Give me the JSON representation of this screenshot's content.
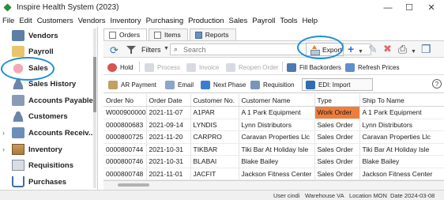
{
  "window": {
    "title": "Inspire Health System (2023)",
    "controls": {
      "minimize": "—",
      "maximize": "☐",
      "close": "✕"
    }
  },
  "menu": [
    "File",
    "Edit",
    "Customers",
    "Vendors",
    "Inventory",
    "Purchasing",
    "Production",
    "Sales",
    "Payroll",
    "Tools",
    "Help"
  ],
  "sidebar": {
    "items": [
      {
        "label": "Vendors",
        "icon": "vendors-icon",
        "expandable": false
      },
      {
        "label": "Payroll",
        "icon": "payroll-icon",
        "expandable": false
      },
      {
        "label": "Sales",
        "icon": "sales-icon",
        "expandable": false,
        "selected": true
      },
      {
        "label": "Sales History",
        "icon": "sales-history-icon",
        "expandable": false
      },
      {
        "label": "Accounts Payable",
        "icon": "accounts-payable-icon",
        "expandable": false
      },
      {
        "label": "Customers",
        "icon": "customers-icon",
        "expandable": false
      },
      {
        "label": "Accounts Receiv...",
        "icon": "accounts-receivable-icon",
        "expandable": true
      },
      {
        "label": "Inventory",
        "icon": "inventory-icon",
        "expandable": true
      },
      {
        "label": "Requisitions",
        "icon": "requisitions-icon",
        "expandable": false
      },
      {
        "label": "Purchases",
        "icon": "purchases-icon",
        "expandable": false
      }
    ]
  },
  "tabs": [
    {
      "label": "Orders",
      "active": true
    },
    {
      "label": "Items",
      "active": false
    },
    {
      "label": "Reports",
      "active": false
    }
  ],
  "toolbar": {
    "filters_label": "Filters",
    "search_placeholder": "Search",
    "export_label": "Export"
  },
  "actions_row1": [
    {
      "label": "Hold",
      "enabled": true
    },
    {
      "label": "Process",
      "enabled": false
    },
    {
      "label": "Invoice",
      "enabled": false
    },
    {
      "label": "Reopen Order",
      "enabled": false
    },
    {
      "label": "Fill Backorders",
      "enabled": true
    },
    {
      "label": "Refresh Prices",
      "enabled": true
    }
  ],
  "actions_row2": [
    {
      "label": "AR Payment",
      "enabled": true
    },
    {
      "label": "Email",
      "enabled": true
    },
    {
      "label": "Next Phase",
      "enabled": true
    },
    {
      "label": "Requisition",
      "enabled": true
    },
    {
      "label": "EDI: Import",
      "enabled": true
    }
  ],
  "table": {
    "columns": [
      "Order No",
      "Order Date",
      "Customer No.",
      "Customer Name",
      "Type",
      "Ship To Name"
    ],
    "rows": [
      [
        "W000900000",
        "2021-11-07",
        "A1PAR",
        "A 1 Park Equipment",
        "Work Order",
        "A 1 Park Equipment"
      ],
      [
        "0000800683",
        "2021-09-14",
        "LYNDIS",
        "Lynn Distributors",
        "Sales Order",
        "Lynn Distributors"
      ],
      [
        "0000800725",
        "2021-11-20",
        "CARPRO",
        "Caravan Properties Llc",
        "Sales Order",
        "Caravan Properties Llc"
      ],
      [
        "0000800744",
        "2021-10-31",
        "TIKBAR",
        "Tiki Bar At Holiday Isle",
        "Sales Order",
        "Tiki Bar At Holiday Isle"
      ],
      [
        "0000800746",
        "2021-10-31",
        "BLABAI",
        "Blake Bailey",
        "Sales Order",
        "Blake Bailey"
      ],
      [
        "0000800748",
        "2021-11-01",
        "JACFIT",
        "Jackson Fitness Center",
        "Sales Order",
        "Jackson Fitness Center"
      ]
    ]
  },
  "status": {
    "user": "User cindi",
    "warehouse": "Warehouse VA",
    "location": "Location MON",
    "date": "Date 2024-03-08"
  },
  "colors": {
    "highlight_ellipse": "#1e8fd8",
    "work_order_cell": "#ef7d3c"
  }
}
